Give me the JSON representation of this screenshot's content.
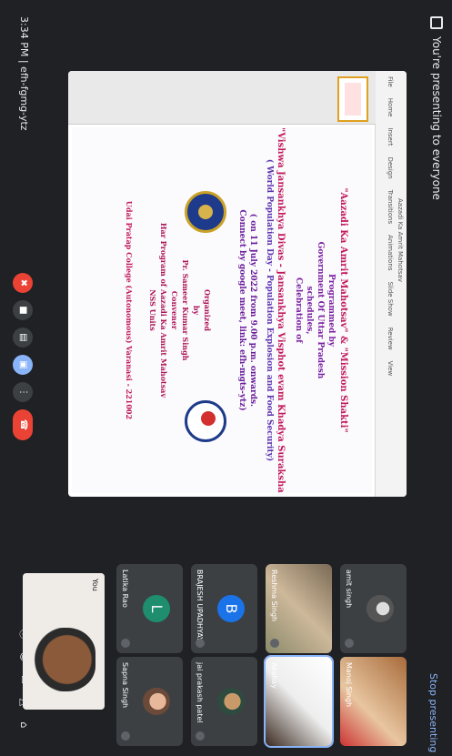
{
  "notice": {
    "text": "You're presenting to everyone",
    "stop_label": "Stop presenting"
  },
  "meeting": {
    "time": "3:34 PM",
    "code": "efh-fgmg-ytz",
    "separator": "|"
  },
  "app_window": {
    "title": "Aazadi Ka Amrit Mahotsav",
    "ribbon": [
      "File",
      "Home",
      "Insert",
      "Design",
      "Transitions",
      "Animations",
      "Slide Show",
      "Review",
      "View"
    ]
  },
  "slide": {
    "lines": [
      "\"Aazadi Ka Amrit Mahotsav\" & \"Mission Shakti\"",
      "Programmed by",
      "Government Of Uttar Pradesh",
      "schedules,",
      "Celebration of",
      "\"Vishwa Jansankhya Divas - Jansankhya Visphot evam Khadya Suraksha \"",
      "( World Population Day - Population Explosion and Food Security)",
      "( on 11 July 2022 from 9.00 p.m. onwards.",
      "Connect by google meet, link: efh-mgts-ytz)",
      "Organized",
      "by",
      "Pr. Sameer Kumar Singh",
      "Convener",
      "Har Program of Aazadi Ka Amrit Mahotsav",
      "NSS Units",
      "Udai Pratap College (Autonomous) Varanasi - 221002"
    ]
  },
  "participants": [
    {
      "name": "amit singh",
      "type": "photo-avatar"
    },
    {
      "name": "Manoj Singh",
      "type": "video"
    },
    {
      "name": "Reshma Singh",
      "type": "video"
    },
    {
      "name": "Akshay",
      "type": "video",
      "active": true
    },
    {
      "name": "BRAJESH UPADHYAY",
      "initial": "B",
      "type": "initial"
    },
    {
      "name": "jai prakash patel",
      "type": "photo-avatar"
    },
    {
      "name": "Latika Rao",
      "initial": "L",
      "type": "initial"
    },
    {
      "name": "Sapna Singh",
      "type": "photo-avatar"
    }
  ],
  "self_view": {
    "label": "You"
  },
  "controls": {
    "icons": [
      "mic-off-icon",
      "camera-off-icon",
      "captions-icon",
      "present-icon",
      "more-icon",
      "end-call-icon"
    ],
    "side_icons": [
      "info-icon",
      "people-icon",
      "chat-icon",
      "activities-icon",
      "lock-icon"
    ]
  },
  "colors": {
    "accent_blue": "#8ab4f8",
    "end_red": "#ea4335",
    "bg": "#202124"
  }
}
